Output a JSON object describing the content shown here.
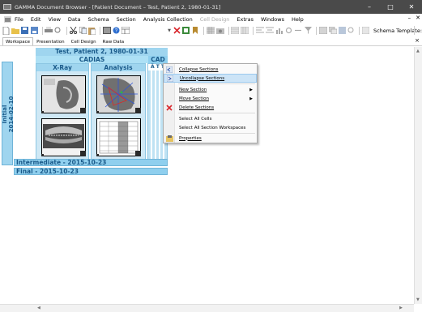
{
  "window": {
    "title": "GAMMA Document Browser - [Patient Document – Test, Patient 2, 1980-01-31]",
    "controls": {
      "minimize": "–",
      "maximize": "□",
      "close": "✕"
    }
  },
  "menubar": {
    "items": [
      {
        "label": "File",
        "disabled": false
      },
      {
        "label": "Edit",
        "disabled": false
      },
      {
        "label": "View",
        "disabled": false
      },
      {
        "label": "Data",
        "disabled": false
      },
      {
        "label": "Schema",
        "disabled": false
      },
      {
        "label": "Section",
        "disabled": false
      },
      {
        "label": "Analysis Collection",
        "disabled": false
      },
      {
        "label": "Cell Design",
        "disabled": true
      },
      {
        "label": "Extras",
        "disabled": false
      },
      {
        "label": "Windows",
        "disabled": false
      },
      {
        "label": "Help",
        "disabled": false
      }
    ],
    "mdi_minimize": "–",
    "mdi_close": "✕"
  },
  "toolbar": {
    "schema_template_label": "Schema Template:"
  },
  "tabs": {
    "items": [
      "Workspace",
      "Presentation",
      "Cell Design",
      "Raw Data"
    ],
    "active": "Workspace",
    "close": "×"
  },
  "document": {
    "patient_title": "Test, Patient 2, 1980-01-31",
    "group_title": "CADIAS",
    "columns": [
      "X-Ray",
      "Analysis"
    ],
    "partial_column": "CAD",
    "partial_column_sub": "Ä T T",
    "sections": {
      "initial": "Initial\n2014-02-10",
      "intermediate": "Intermediate - 2015-10-23",
      "final": "Final - 2015-10-23"
    }
  },
  "context_menu": {
    "items": [
      {
        "label": "Collapse Sections",
        "icon": "collapse-icon",
        "submenu": false,
        "hover": false
      },
      {
        "label": "Uncollapse Sections",
        "icon": "uncollapse-icon",
        "submenu": false,
        "hover": true
      },
      {
        "label": "New Section",
        "icon": "",
        "submenu": true,
        "hover": false
      },
      {
        "label": "Move Section",
        "icon": "",
        "submenu": true,
        "hover": false
      },
      {
        "label": "Delete Sections",
        "icon": "delete-x-icon",
        "submenu": false,
        "hover": false
      },
      {
        "label": "Select All Cells",
        "icon": "",
        "submenu": false,
        "hover": false
      },
      {
        "label": "Select All Section Workspaces",
        "icon": "",
        "submenu": false,
        "hover": false
      },
      {
        "label": "Properties",
        "icon": "properties-icon",
        "submenu": false,
        "hover": false
      }
    ],
    "submenu_arrow": "▶"
  },
  "colors": {
    "section_blue": "#8fcfee",
    "header_blue": "#9fd5ef",
    "text_blue": "#1a5a8a",
    "hover_blue": "#cce4f7",
    "delete_red": "#d9262c"
  }
}
